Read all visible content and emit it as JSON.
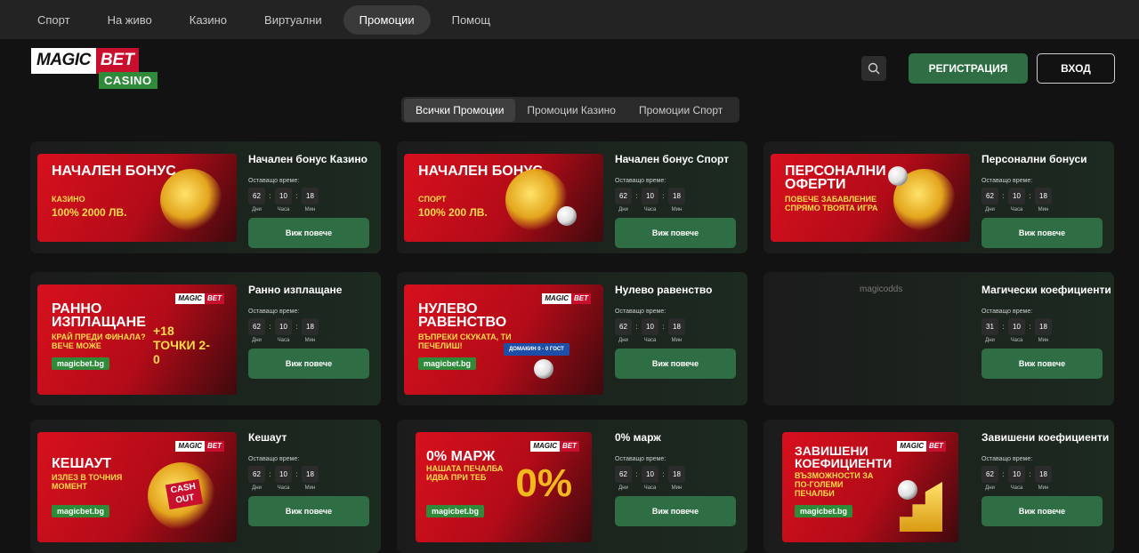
{
  "nav": {
    "items": [
      {
        "label": "Спорт"
      },
      {
        "label": "На живо"
      },
      {
        "label": "Казино"
      },
      {
        "label": "Виртуални"
      },
      {
        "label": "Промоции"
      },
      {
        "label": "Помощ"
      }
    ],
    "active": "Промоции"
  },
  "logo": {
    "part1": "MAGIC",
    "part2": "BET",
    "part3": "CASINO"
  },
  "header": {
    "search_icon": "search-icon",
    "register_label": "РЕГИСТРАЦИЯ",
    "login_label": "ВХОД"
  },
  "filter_tabs": [
    {
      "label": "Всички Промоции"
    },
    {
      "label": "Промоции Казино"
    },
    {
      "label": "Промоции Спорт"
    }
  ],
  "timer_units": {
    "days": "Дни",
    "hours": "Часа",
    "minutes": "Мин"
  },
  "promos": [
    {
      "title": "Начален бонус Казино",
      "remaining_label": "Оставащо време:",
      "days": "62",
      "hours": "10",
      "minutes": "18",
      "button": "Виж повече",
      "banner": {
        "title": "НАЧАЛЕН БОНУС",
        "sub": "КАЗИНО",
        "big": "100% 2000 ЛВ."
      }
    },
    {
      "title": "Начален бонус Спорт",
      "remaining_label": "Оставащо време:",
      "days": "62",
      "hours": "10",
      "minutes": "18",
      "button": "Виж повече",
      "banner": {
        "title": "НАЧАЛЕН БОНУС",
        "sub": "СПОРТ",
        "big": "100% 200 ЛВ."
      }
    },
    {
      "title": "Персонални бонуси",
      "remaining_label": "Оставащо време:",
      "days": "62",
      "hours": "10",
      "minutes": "18",
      "button": "Виж повече",
      "banner": {
        "title": "ПЕРСОНАЛНИ ОФЕРТИ",
        "sub": "ПОВЕЧЕ ЗАБАВЛЕНИЕ СПРЯМО ТВОЯТА ИГРА"
      }
    },
    {
      "title": "Ранно изплащане",
      "remaining_label": "Оставащо време:",
      "days": "62",
      "hours": "10",
      "minutes": "18",
      "button": "Виж повече",
      "banner": {
        "title": "РАННО ИЗПЛАЩАНЕ",
        "sub": "КРАЙ ПРЕДИ ФИНАЛА? ВЕЧЕ МОЖЕ",
        "big": "+18 ТОЧКИ 2-0",
        "site": "magicbet.bg"
      }
    },
    {
      "title": "Нулево равенство",
      "remaining_label": "Оставащо време:",
      "days": "62",
      "hours": "10",
      "minutes": "18",
      "button": "Виж повече",
      "banner": {
        "title": "НУЛЕВО РАВЕНСТВО",
        "sub": "ВЪПРЕКИ СКУКАТА, ТИ ПЕЧЕЛИШ!",
        "site": "magicbet.bg",
        "score": "ДОМАКИН 0 - 0 ГОСТ"
      }
    },
    {
      "title": "Магически коефициенти",
      "remaining_label": "Оставащо време:",
      "days": "31",
      "hours": "10",
      "minutes": "18",
      "button": "Виж повече",
      "banner": {
        "broken_alt": "magicodds"
      }
    },
    {
      "title": "Кешаут",
      "remaining_label": "Оставащо време:",
      "days": "62",
      "hours": "10",
      "minutes": "18",
      "button": "Виж повече",
      "banner": {
        "title": "КЕШАУТ",
        "sub": "ИЗЛЕЗ В ТОЧНИЯ МОМЕНТ",
        "big": "CASH OUT",
        "site": "magicbet.bg"
      }
    },
    {
      "title": "0% марж",
      "remaining_label": "Оставащо време:",
      "days": "62",
      "hours": "10",
      "minutes": "18",
      "button": "Виж повече",
      "banner": {
        "title": "0% МАРЖ",
        "sub": "НАШАТА ПЕЧАЛБА ИДВА ПРИ ТЕБ",
        "big": "0%",
        "site": "magicbet.bg"
      }
    },
    {
      "title": "Завишени коефициенти",
      "remaining_label": "Оставащо време:",
      "days": "62",
      "hours": "10",
      "minutes": "18",
      "button": "Виж повече",
      "banner": {
        "title": "ЗАВИШЕНИ КОЕФИЦИЕНТИ",
        "sub": "ВЪЗМОЖНОСТИ ЗА ПО-ГОЛЕМИ ПЕЧАЛБИ",
        "site": "magicbet.bg"
      }
    }
  ],
  "colors": {
    "background": "#121212",
    "accent_green": "#2f6e44",
    "banner_red": "#d8101e",
    "gold": "#ffdc4a"
  }
}
